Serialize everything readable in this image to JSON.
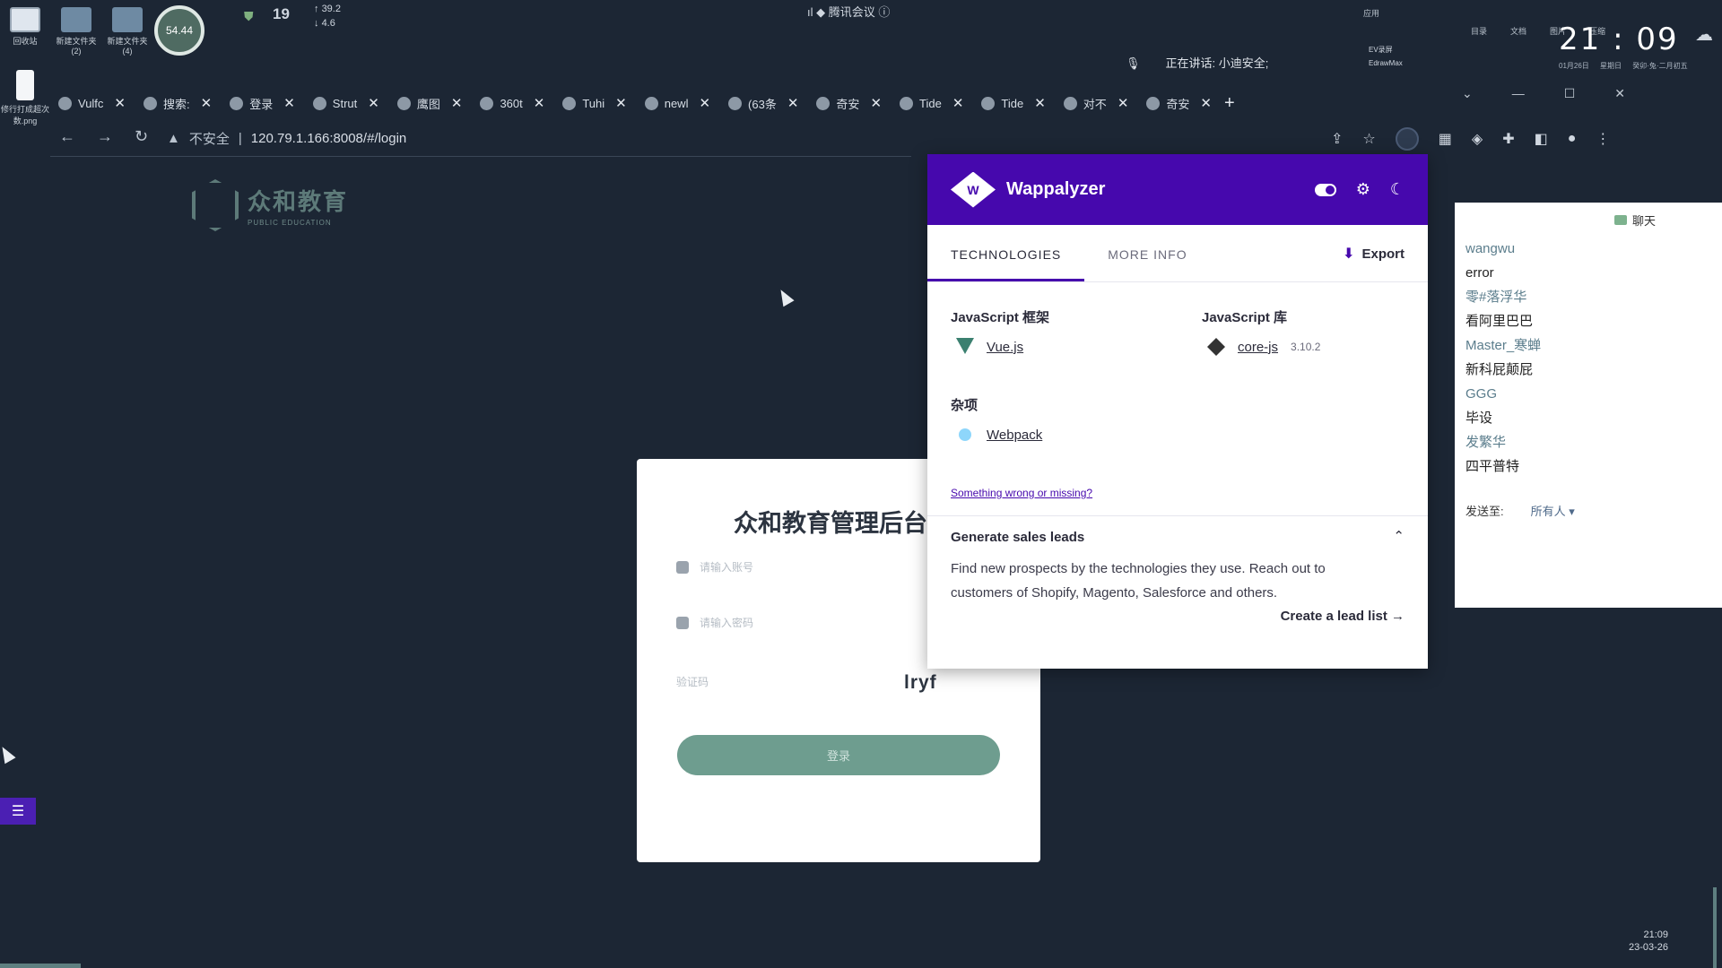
{
  "desktop": {
    "icons": [
      {
        "label": "回收站"
      },
      {
        "label": "新建文件夹 (2)"
      },
      {
        "label": "新建文件夹 (4)"
      }
    ],
    "file_label": "修行打成超次数.png",
    "net_circle": "54.44",
    "cpu_temp": "19",
    "net_up": "39.2",
    "net_down": "4.6"
  },
  "meeting": {
    "title": "腾讯会议",
    "speaking": "正在讲话: 小迪安全;"
  },
  "tabs": [
    {
      "label": "Vulfc"
    },
    {
      "label": "搜索:"
    },
    {
      "label": "登录"
    },
    {
      "label": "Strut"
    },
    {
      "label": "鹰图"
    },
    {
      "label": "360t"
    },
    {
      "label": "Tuhi"
    },
    {
      "label": "newl"
    },
    {
      "label": "(63条"
    },
    {
      "label": "奇安"
    },
    {
      "label": "Tide"
    },
    {
      "label": "Tide"
    },
    {
      "label": "对不"
    },
    {
      "label": "奇安"
    }
  ],
  "new_tab": "+",
  "address": {
    "warning": "不安全",
    "url": "120.79.1.166:8008/#/login"
  },
  "tray": {
    "apps_label": "应用",
    "tray_items": [
      "目录",
      "文档",
      "图片",
      "压缩"
    ],
    "clock": "21 : 09",
    "date": "01月26日",
    "weekday": "星期日",
    "lunar": "癸卯·兔·二月初五",
    "ev_label": "EV录屏",
    "edraw_label": "EdrawMax"
  },
  "app": {
    "logo_cn": "众和教育",
    "logo_en": "PUBLIC EDUCATION"
  },
  "login": {
    "title": "众和教育管理后台",
    "username_placeholder": "请输入账号",
    "password_placeholder": "请输入密码",
    "captcha_placeholder": "验证码",
    "captcha_text": "lryf",
    "button": "登录"
  },
  "wappalyzer": {
    "name": "Wappalyzer",
    "tabs": [
      "TECHNOLOGIES",
      "MORE INFO"
    ],
    "export": "Export",
    "categories": [
      {
        "name": "JavaScript 框架",
        "techs": [
          {
            "name": "Vue.js",
            "version": ""
          }
        ]
      },
      {
        "name": "JavaScript 库",
        "techs": [
          {
            "name": "core-js",
            "version": "3.10.2"
          }
        ]
      },
      {
        "name": "杂项",
        "techs": [
          {
            "name": "Webpack",
            "version": ""
          }
        ]
      }
    ],
    "wrong": "Something wrong or missing?",
    "leads_title": "Generate sales leads",
    "leads_text": "Find new prospects by the technologies they use. Reach out to customers of Shopify, Magento, Salesforce and others.",
    "lead_link": "Create a lead list"
  },
  "chat": {
    "title": "聊天",
    "items": [
      "wangwu",
      "error",
      "零#落浮华",
      "看阿里巴巴",
      "Master_寒蝉",
      "新科屁颠屁",
      "GGG",
      "毕设",
      "发繁华",
      "四平普特"
    ],
    "send_label": "发送至:",
    "send_target": "所有人"
  },
  "bottom": {
    "time": "21:09",
    "date": "23-03-26"
  },
  "colors": {
    "desktop_bg": "#1c2634",
    "wappalyzer_purple": "#4608ad",
    "login_button": "#6e9d8f",
    "logo_teal": "#5d7a79"
  }
}
